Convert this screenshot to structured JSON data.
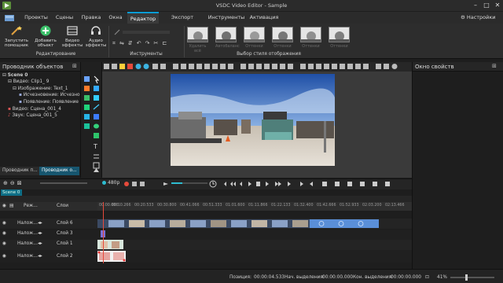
{
  "window": {
    "title": "VSDC Video Editor - Sample"
  },
  "menu": {
    "items": [
      "Проекты",
      "Сцены",
      "Правка",
      "Окна",
      "Редактор",
      "Экспорт проекта",
      "Инструменты",
      "Активация"
    ],
    "active_index": 4,
    "settings_label": "Настройки"
  },
  "ribbon": {
    "launch_wizard": "Запустить помощник",
    "add_object": "Добавить объект",
    "video_effects": "Видео эффекты",
    "audio_effects": "Аудио эффекты",
    "group_editing": "Редактирование",
    "group_tools": "Инструменты",
    "group_style": "Выбор стиля отображения",
    "delete_all": "Удалить всё",
    "auto_levels": "Автобаланс",
    "styles": [
      "Удалить всё",
      "Автобаланс",
      "Оттенки",
      "Оттенки",
      "Оттенки",
      "Оттенки",
      "Оттенки"
    ]
  },
  "objects_panel": {
    "title": "Проводник объектов",
    "tree": [
      "Scene 0",
      "Видео: Clip1_ 9",
      "Изображение: Text_1",
      "Исчезновение: Исчезно",
      "Появление: Появление",
      "Видео: Сцена_001_4",
      "Звук: Сцена_001_5"
    ],
    "tabs": [
      "Проводник п...",
      "Проводник о..."
    ]
  },
  "props_panel": {
    "title": "Окно свойств"
  },
  "playback": {
    "quality": "480p"
  },
  "timeline": {
    "scene_tab": "Scene 0",
    "mode_label": "Реж...",
    "layers_label": "Слои",
    "ruler_ticks": [
      "00:00.000",
      "00:10.266",
      "00:20.533",
      "00:30.800",
      "00:41.066",
      "00:51.333",
      "01:01.600",
      "01:11.866",
      "01:22.133",
      "01:32.400",
      "01:42.666",
      "01:52.933",
      "02:03.200",
      "02:13.466"
    ],
    "tracks": [
      {
        "mode": "Налож...",
        "layer": "Слой 6"
      },
      {
        "mode": "Налож...",
        "layer": "Слой 3"
      },
      {
        "mode": "Налож...",
        "layer": "Слой 1"
      },
      {
        "mode": "Налож...",
        "layer": "Слой 2"
      }
    ]
  },
  "status": {
    "position_label": "Позиция:",
    "position_value": "00:00:04.533",
    "sel_start_label": "Нач. выделения:",
    "sel_start_value": "00:00:00.000",
    "sel_end_label": "Кон. выделения:",
    "sel_end_value": "00:00:00.000",
    "zoom": "41%"
  },
  "colors": {
    "accent": "#0b9cd4",
    "teal": "#17566f",
    "clip_blue": "#5a8fd8"
  }
}
